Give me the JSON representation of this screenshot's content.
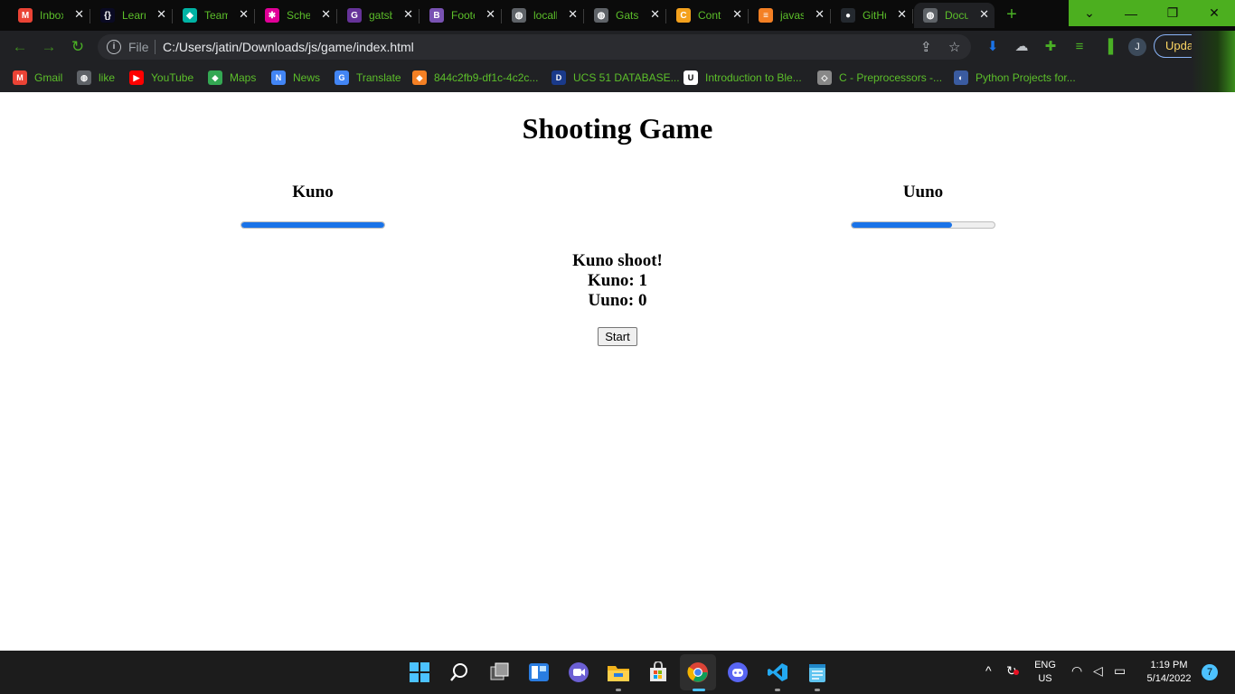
{
  "browser": {
    "tabs": [
      {
        "label": "Inbox",
        "icon": "gmail-icon",
        "color": "#ea4335",
        "glyph": "M"
      },
      {
        "label": "Learn",
        "icon": "freecodecamp-icon",
        "color": "#0a0a23",
        "glyph": "{}"
      },
      {
        "label": "Team",
        "icon": "diamond-icon",
        "color": "#00b3a4",
        "glyph": "◆"
      },
      {
        "label": "Schedule",
        "icon": "graphql-icon",
        "color": "#e10098",
        "glyph": "✱"
      },
      {
        "label": "gatsby",
        "icon": "gatsby-icon",
        "color": "#663399",
        "glyph": "G"
      },
      {
        "label": "Footer",
        "icon": "bootstrap-icon",
        "color": "#7952b3",
        "glyph": "B"
      },
      {
        "label": "localhost",
        "icon": "globe-icon",
        "color": "#5f6368",
        "glyph": "◍"
      },
      {
        "label": "Gatsby",
        "icon": "globe-icon",
        "color": "#5f6368",
        "glyph": "◍"
      },
      {
        "label": "Contest",
        "icon": "codechef-icon",
        "color": "#f4a11d",
        "glyph": "C"
      },
      {
        "label": "javascript",
        "icon": "stackoverflow-icon",
        "color": "#f48024",
        "glyph": "≡"
      },
      {
        "label": "GitHub",
        "icon": "github-icon",
        "color": "#24292f",
        "glyph": "●"
      },
      {
        "label": "Document",
        "icon": "globe-icon",
        "color": "#5f6368",
        "glyph": "◍"
      }
    ],
    "address": {
      "scheme_label": "File",
      "url": "C:/Users/jatin/Downloads/js/game/index.html"
    },
    "profile_initial": "J",
    "update_label": "Update",
    "bookmarks": [
      {
        "label": "Gmail",
        "color": "#ea4335",
        "glyph": "M"
      },
      {
        "label": "like",
        "color": "#5f6368",
        "glyph": "◍"
      },
      {
        "label": "YouTube",
        "color": "#ff0000",
        "glyph": "▶"
      },
      {
        "label": "Maps",
        "color": "#34a853",
        "glyph": "◆"
      },
      {
        "label": "News",
        "color": "#4285f4",
        "glyph": "N"
      },
      {
        "label": "Translate",
        "color": "#4285f4",
        "glyph": "G"
      },
      {
        "label": "844c2fb9-df1c-4c2c...",
        "color": "#f48024",
        "glyph": "◆"
      },
      {
        "label": "UCS 51 DATABASE...",
        "color": "#1a3a8a",
        "glyph": "D"
      },
      {
        "label": "Introduction to Ble...",
        "color": "#ffffff",
        "glyph": "U"
      },
      {
        "label": "C - Preprocessors -...",
        "color": "#888888",
        "glyph": "◇"
      },
      {
        "label": "Python Projects for...",
        "color": "#3a5ba0",
        "glyph": "◐"
      }
    ]
  },
  "page": {
    "title": "Shooting Game",
    "players": [
      {
        "name": "Kuno",
        "health_fraction": 1.0
      },
      {
        "name": "Uuno",
        "health_fraction": 0.7
      }
    ],
    "status_message": "Kuno shoot!",
    "scores": [
      "Kuno: 1",
      "Uuno: 0"
    ],
    "start_label": "Start",
    "accent_color": "#1a73e8"
  },
  "taskbar": {
    "language": [
      "ENG",
      "US"
    ],
    "time": "1:19 PM",
    "date": "5/14/2022",
    "notification_count": "7"
  }
}
